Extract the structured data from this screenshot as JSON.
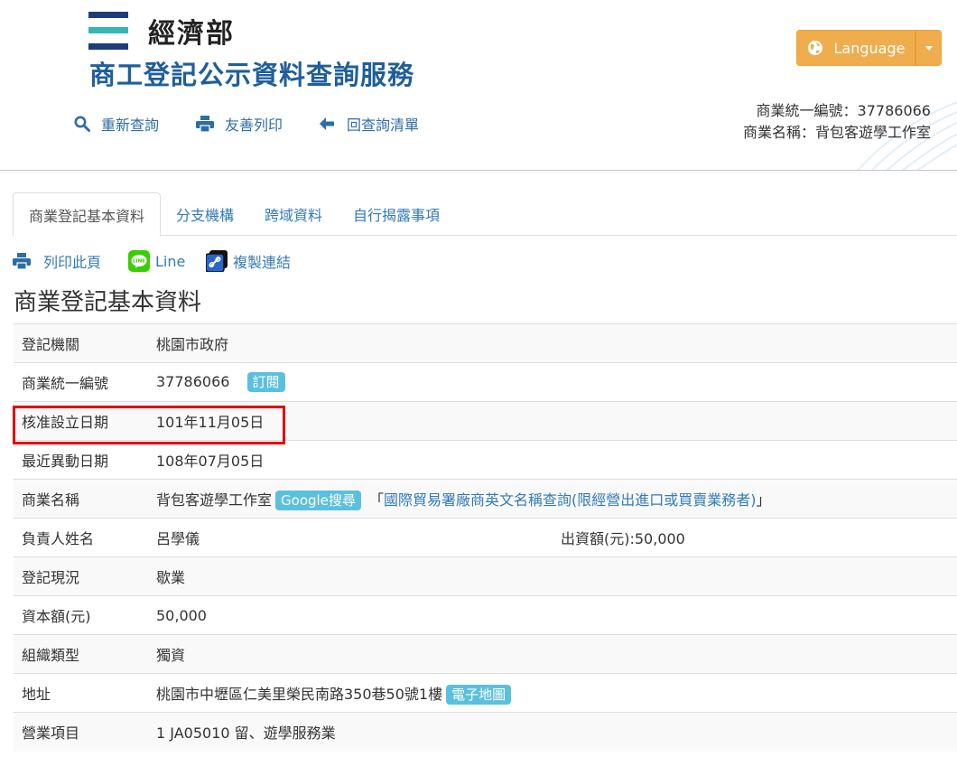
{
  "header": {
    "ministry": "經濟部",
    "site_title": "商工登記公示資料查詢服務",
    "toolbar": {
      "requery": "重新查詢",
      "print": "友善列印",
      "back_list": "回查詢清單"
    },
    "language_label": "Language",
    "biz_id_line": "商業統一編號：37786066",
    "biz_name_line": "商業名稱：背包客遊學工作室"
  },
  "tabs": [
    "商業登記基本資料",
    "分支機構",
    "跨域資料",
    "自行揭露事項"
  ],
  "actions": {
    "print_page": "列印此頁",
    "line": "Line",
    "copy_link": "複製連結",
    "line_icon_text": "LINE"
  },
  "section_title": "商業登記基本資料",
  "rows": {
    "authority": {
      "label": "登記機關",
      "value": "桃園市政府"
    },
    "biz_id": {
      "label": "商業統一編號",
      "value": "37786066",
      "badge": "訂閱"
    },
    "approved_date": {
      "label": "核准設立日期",
      "value": "101年11月05日"
    },
    "last_change": {
      "label": "最近異動日期",
      "value": "108年07月05日"
    },
    "biz_name": {
      "label": "商業名稱",
      "value": "背包客遊學工作室",
      "google_badge": "Google搜尋",
      "bracket_open": "「",
      "trade_link": "國際貿易署廠商英文名稱查詢(限經營出進口或買賣業務者)",
      "bracket_close": "」"
    },
    "owner": {
      "label": "負責人姓名",
      "value": "呂學儀",
      "investment": "出資額(元):50,000"
    },
    "status": {
      "label": "登記現況",
      "value": "歇業"
    },
    "capital": {
      "label": "資本額(元)",
      "value": "50,000"
    },
    "org_type": {
      "label": "組織類型",
      "value": "獨資"
    },
    "address": {
      "label": "地址",
      "value": "桃園市中壢區仁美里榮民南路350巷50號1樓",
      "map_badge": "電子地圖"
    },
    "business": {
      "label": "營業項目",
      "value": "1 JA05010 留、遊學服務業"
    }
  },
  "colors": {
    "accent_blue": "#1f5f9a",
    "link_blue": "#337ab7",
    "language_orange": "#f0ad4e",
    "badge_info": "#5bc0de",
    "highlight_red": "#e30000",
    "line_green": "#3ace01"
  }
}
